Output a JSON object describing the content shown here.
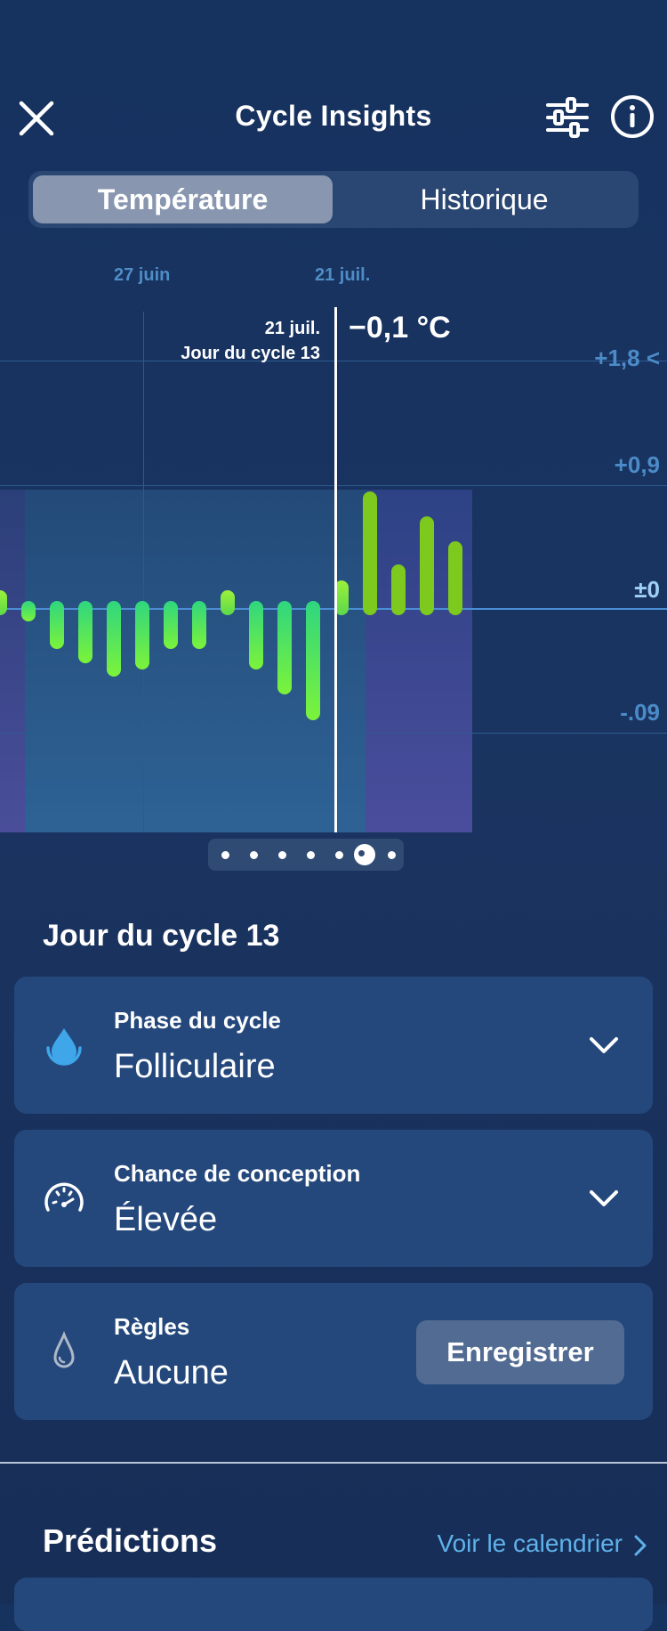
{
  "header": {
    "title": "Cycle Insights"
  },
  "tabs": [
    {
      "label": "Température",
      "active": true
    },
    {
      "label": "Historique",
      "active": false
    }
  ],
  "chart_data": {
    "type": "bar",
    "date_labels": [
      "27 juin",
      "21 juil."
    ],
    "y_ticks": [
      "+1,8 <",
      "+0,9",
      "±0",
      "-.09"
    ],
    "selected": {
      "date": "21 juil.",
      "cycle_day": "Jour du cycle 13",
      "value": "−0,1 °C"
    },
    "values": [
      0.18,
      -0.15,
      -0.35,
      -0.45,
      -0.55,
      -0.5,
      -0.35,
      -0.35,
      0.18,
      -0.5,
      -0.68,
      -0.87,
      0.25,
      0.9,
      0.37,
      0.72,
      0.54
    ],
    "ylim": [
      -1.35,
      1.8
    ],
    "colors": {
      "follicular_bar": "#4ef08a",
      "luteal_bar": "#7dc91e",
      "zero_line": "#4a8ed4"
    }
  },
  "pager": {
    "count": 7,
    "active_index": 5
  },
  "day_section": {
    "title": "Jour du cycle 13"
  },
  "cards": {
    "phase": {
      "label": "Phase du cycle",
      "value": "Folliculaire"
    },
    "conception": {
      "label": "Chance de conception",
      "value": "Élevée"
    },
    "period": {
      "label": "Règles",
      "value": "Aucune",
      "button": "Enregistrer"
    }
  },
  "predictions": {
    "title": "Prédictions",
    "link": "Voir le calendrier"
  }
}
